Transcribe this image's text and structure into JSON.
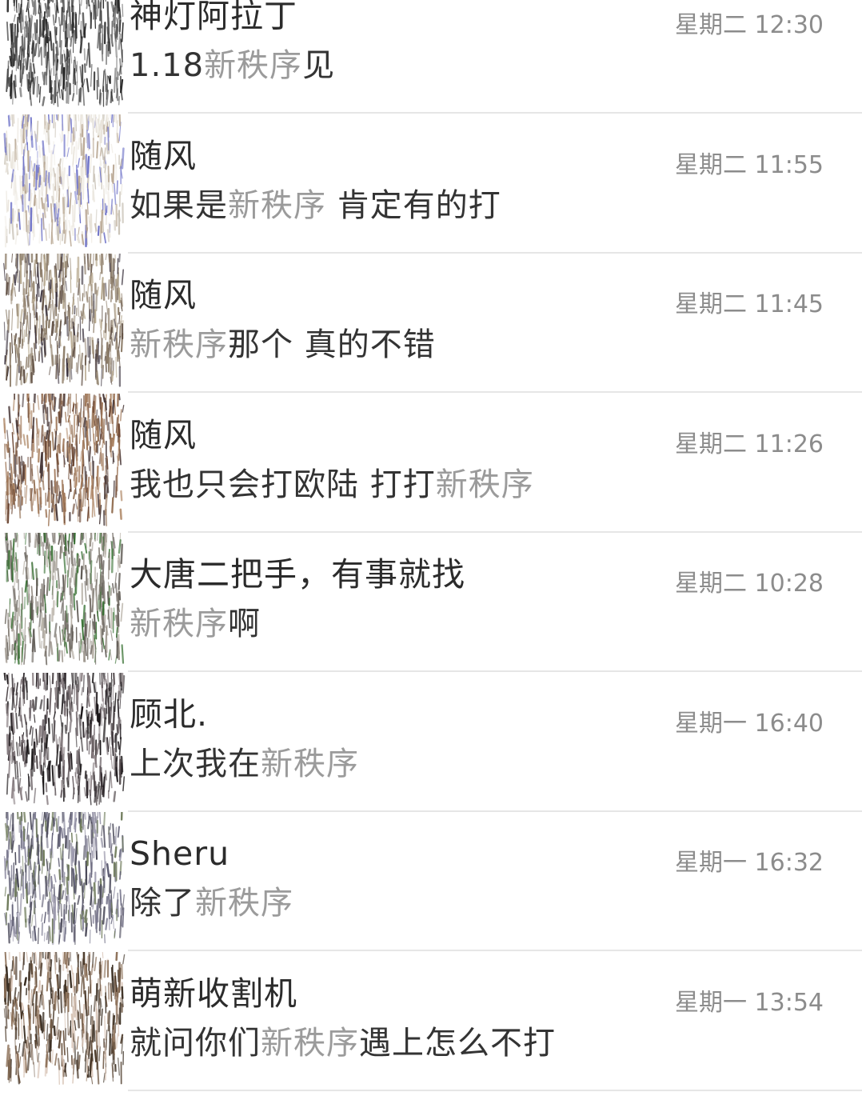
{
  "highlight_color": "#9b9b9b",
  "conversations": [
    {
      "name": "神灯阿拉丁",
      "time": "星期二 12:30",
      "message": [
        {
          "t": "1.18",
          "hl": false
        },
        {
          "t": "新秩序",
          "hl": true
        },
        {
          "t": "见",
          "hl": false
        }
      ],
      "avatar_colors": [
        "#1e1e1e",
        "#3a3a3a",
        "#5c5c5c",
        "#2c2c2c",
        "#7a7a7a"
      ]
    },
    {
      "name": "随风",
      "time": "星期二 11:55",
      "message": [
        {
          "t": "如果是",
          "hl": false
        },
        {
          "t": "新秩序",
          "hl": true
        },
        {
          "t": " 肯定有的打",
          "hl": false
        }
      ],
      "avatar_colors": [
        "#e8e3da",
        "#c9c2b6",
        "#f2efe9",
        "#6f73c8",
        "#b6a48f"
      ]
    },
    {
      "name": "随风",
      "time": "星期二 11:45",
      "message": [
        {
          "t": "新秩序",
          "hl": true
        },
        {
          "t": "那个 真的不错",
          "hl": false
        }
      ],
      "avatar_colors": [
        "#8a7a66",
        "#5b4a3e",
        "#b7a98f",
        "#3d3540",
        "#9a8b78"
      ]
    },
    {
      "name": "随风",
      "time": "星期二 11:26",
      "message": [
        {
          "t": "我也只会打欧陆 打打",
          "hl": false
        },
        {
          "t": "新秩序",
          "hl": true
        }
      ],
      "avatar_colors": [
        "#8f6a4d",
        "#6b4632",
        "#b08a6a",
        "#4a3a3a",
        "#a0785a"
      ]
    },
    {
      "name": "大唐二把手，有事就找",
      "time": "星期二 10:28",
      "message": [
        {
          "t": "新秩序",
          "hl": true
        },
        {
          "t": "啊",
          "hl": false
        }
      ],
      "avatar_colors": [
        "#9a938a",
        "#7b756d",
        "#b8b2a8",
        "#5f5a54",
        "#2f6b2a"
      ]
    },
    {
      "name": "顾北.",
      "time": "星期一 16:40",
      "message": [
        {
          "t": "上次我在",
          "hl": false
        },
        {
          "t": "新秩序",
          "hl": true
        }
      ],
      "avatar_colors": [
        "#2a2428",
        "#4e4548",
        "#6d6468",
        "#1a1618",
        "#8a8083"
      ]
    },
    {
      "name": "Sheru",
      "time": "星期一 16:32",
      "message": [
        {
          "t": "除了",
          "hl": false
        },
        {
          "t": "新秩序",
          "hl": true
        }
      ],
      "avatar_colors": [
        "#7b7a8f",
        "#5d5c72",
        "#9c9aad",
        "#4b4a5a",
        "#6e7a5a"
      ]
    },
    {
      "name": "萌新收割机",
      "time": "星期一 13:54",
      "message": [
        {
          "t": "就问你们",
          "hl": false
        },
        {
          "t": "新秩序",
          "hl": true
        },
        {
          "t": "遇上怎么不打",
          "hl": false
        }
      ],
      "avatar_colors": [
        "#6b5440",
        "#4a3828",
        "#8c7058",
        "#3a2e22",
        "#d8c4b6"
      ]
    }
  ]
}
